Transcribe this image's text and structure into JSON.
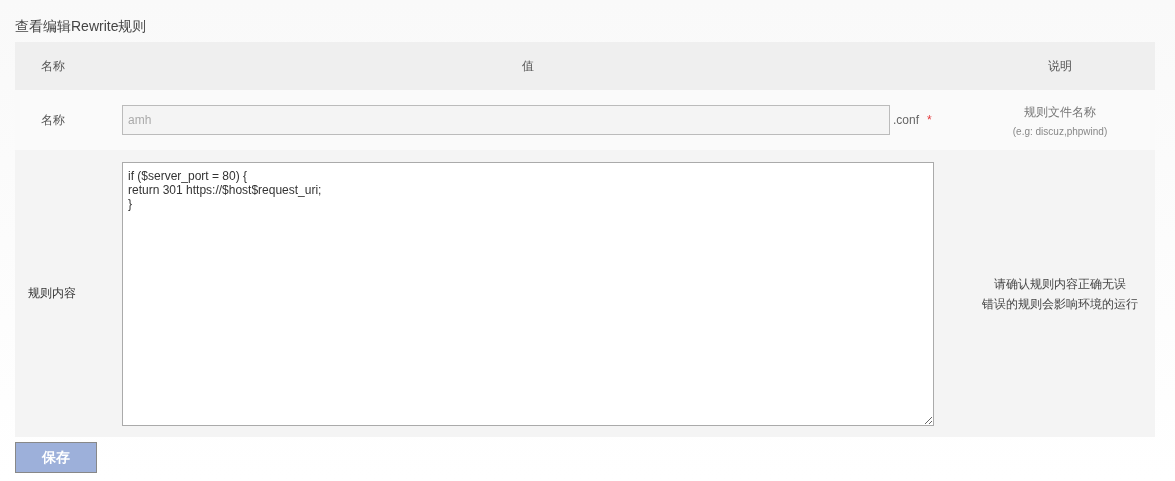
{
  "page_title": "查看编辑Rewrite规则",
  "table": {
    "columns": [
      "名称",
      "值",
      "说明"
    ],
    "name_row": {
      "label": "名称",
      "input": {
        "value": "amh",
        "disabled": true
      },
      "suffix": ".conf",
      "required_mark": "*",
      "note": "规则文件名称",
      "hint": "(e.g: discuz,phpwind)"
    },
    "content_row": {
      "label": "规则内容",
      "textarea": {
        "value": "if ($server_port = 80) {\nreturn 301 https://$host$request_uri;\n}"
      },
      "note_lines": [
        "请确认规则内容正确无误",
        "错误的规则会影响环境的运行"
      ]
    }
  },
  "save_button": {
    "label": "保存"
  }
}
